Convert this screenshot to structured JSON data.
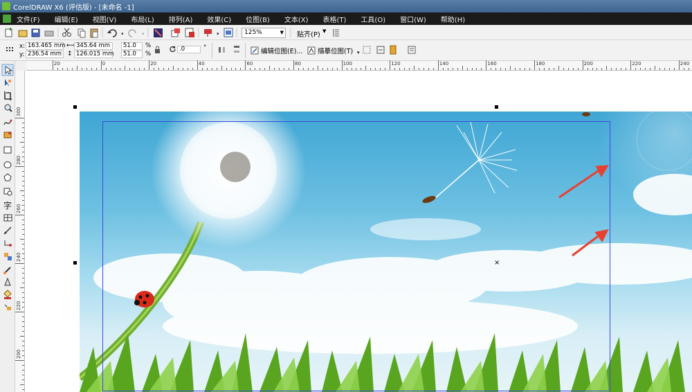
{
  "window": {
    "title": "CorelDRAW X6 (评估版) - [未命名 -1]"
  },
  "menu": {
    "items": [
      {
        "label": "文件(F)"
      },
      {
        "label": "编辑(E)"
      },
      {
        "label": "视图(V)"
      },
      {
        "label": "布局(L)"
      },
      {
        "label": "排列(A)"
      },
      {
        "label": "效果(C)"
      },
      {
        "label": "位图(B)"
      },
      {
        "label": "文本(X)"
      },
      {
        "label": "表格(T)"
      },
      {
        "label": "工具(O)"
      },
      {
        "label": "窗口(W)"
      },
      {
        "label": "帮助(H)"
      }
    ]
  },
  "toolbar": {
    "zoom": "125%",
    "snap_label": "贴齐(P)"
  },
  "propertybar": {
    "x_label": "x:",
    "x_value": "163.465 mm",
    "y_label": "y:",
    "y_value": "236.54 mm",
    "width_value": "345.64 mm",
    "height_value": "126.015 mm",
    "scale_x": "51.0",
    "scale_y": "51.0",
    "percent": "%",
    "rotation": ".0",
    "degree": "°",
    "edit_bitmap": "编辑位图(E)...",
    "trace_bitmap": "描摹位图(T)"
  },
  "ruler": {
    "h_labels": [
      "20",
      "0",
      "20",
      "40",
      "60",
      "80",
      "100",
      "120",
      "140",
      "160",
      "180",
      "200",
      "220",
      "240"
    ],
    "v_labels": [
      "300",
      "280",
      "260",
      "240",
      "220",
      "200"
    ]
  },
  "colors": {
    "accent": "#3b4bd9",
    "arrow": "#e8412f",
    "menubar_bg": "#1b1b1b"
  }
}
